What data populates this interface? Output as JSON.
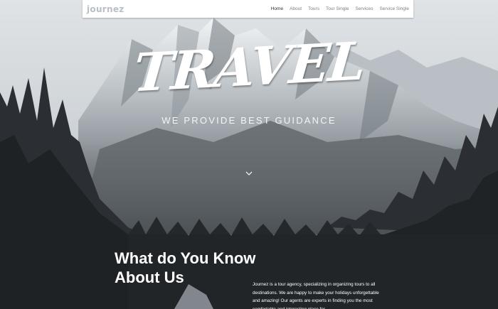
{
  "header": {
    "logo": "journez",
    "nav": [
      "Home",
      "About",
      "Tours",
      "Tour Single",
      "Services",
      "Service Single"
    ]
  },
  "hero": {
    "title": "TRAVEL",
    "subtitle": "WE PROVIDE BEST GUIDANCE",
    "scroll_icon": "chevron-down-icon"
  },
  "about": {
    "heading_line1": "What do You Know",
    "heading_line2": "About Us",
    "body": "Journez is a tour agency, specializing in organizing tours to all destinations. We are happy to make your holidays unforgettable and amazing! Our agents are experts in finding you the most comfortable and interesting place for"
  },
  "colors": {
    "nav_bg": "#ffffff",
    "logo": "#b9bec4",
    "hero_text": "#ffffff"
  }
}
